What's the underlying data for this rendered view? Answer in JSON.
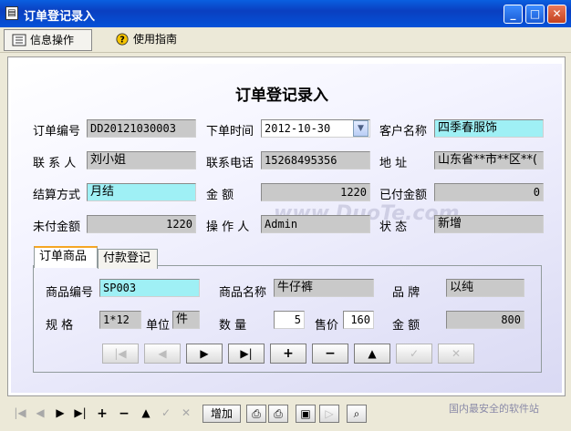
{
  "window": {
    "title": "订单登记录入",
    "app_icon": "document-icon"
  },
  "toolbar": {
    "info_ops": "信息操作",
    "guide": "使用指南"
  },
  "form": {
    "page_title": "订单登记录入",
    "order_no": {
      "label": "订单编号",
      "value": "DD20121030003"
    },
    "order_time": {
      "label": "下单时间",
      "value": "2012-10-30"
    },
    "customer": {
      "label": "客户名称",
      "value": "四季春服饰"
    },
    "contact": {
      "label": "联 系 人",
      "value": "刘小姐"
    },
    "phone": {
      "label": "联系电话",
      "value": "15268495356"
    },
    "address": {
      "label": "地   址",
      "value": "山东省**市**区**("
    },
    "settle": {
      "label": "结算方式",
      "value": "月结"
    },
    "amount": {
      "label": "金   额",
      "value": "1220"
    },
    "paid": {
      "label": "已付金额",
      "value": "0"
    },
    "unpaid": {
      "label": "未付金额",
      "value": "1220"
    },
    "operator": {
      "label": "操 作 人",
      "value": "Admin"
    },
    "status": {
      "label": "状   态",
      "value": "新增"
    }
  },
  "tabs": [
    {
      "label": "订单商品"
    },
    {
      "label": "付款登记"
    }
  ],
  "goods": {
    "code": {
      "label": "商品编号",
      "value": "SP003"
    },
    "name": {
      "label": "商品名称",
      "value": "牛仔裤"
    },
    "brand": {
      "label": "品   牌",
      "value": "以纯"
    },
    "spec": {
      "label": "规   格",
      "value": "1*12"
    },
    "unit": {
      "label": "单位",
      "value": "件"
    },
    "qty": {
      "label": "数   量",
      "value": "5"
    },
    "price": {
      "label": "售价",
      "value": "160"
    },
    "amount": {
      "label": "金   额",
      "value": "800"
    }
  },
  "record_nav": [
    "first-icon",
    "prev-icon",
    "next-icon",
    "last-icon",
    "add-icon",
    "delete-icon",
    "edit-icon",
    "save-icon",
    "cancel-icon"
  ],
  "bottom": {
    "add_label": "增加"
  },
  "watermark": {
    "text": "www.DuoTe.com",
    "corner": "国内最安全的软件站"
  }
}
